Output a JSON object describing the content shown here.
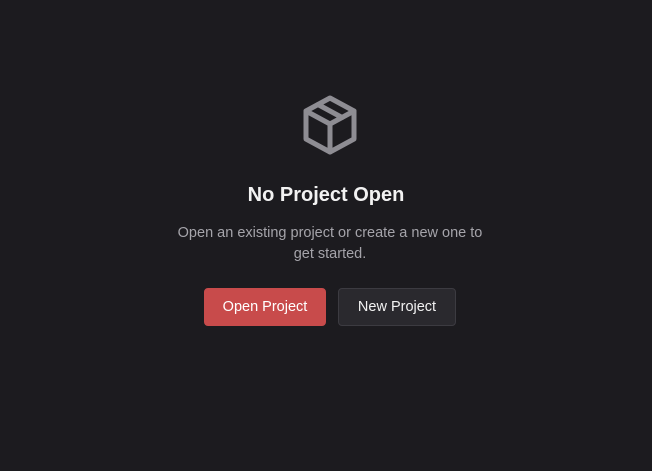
{
  "empty_state": {
    "icon": "package-icon",
    "title": "No Project Open",
    "description": "Open an existing project or create a new one to get started.",
    "actions": {
      "open_label": "Open Project",
      "new_label": "New Project"
    }
  },
  "colors": {
    "background": "#1c1b1f",
    "primary_button": "#c84b4b",
    "secondary_button": "#2a292e",
    "icon": "#8e8d93",
    "muted_text": "#a5a4aa"
  }
}
